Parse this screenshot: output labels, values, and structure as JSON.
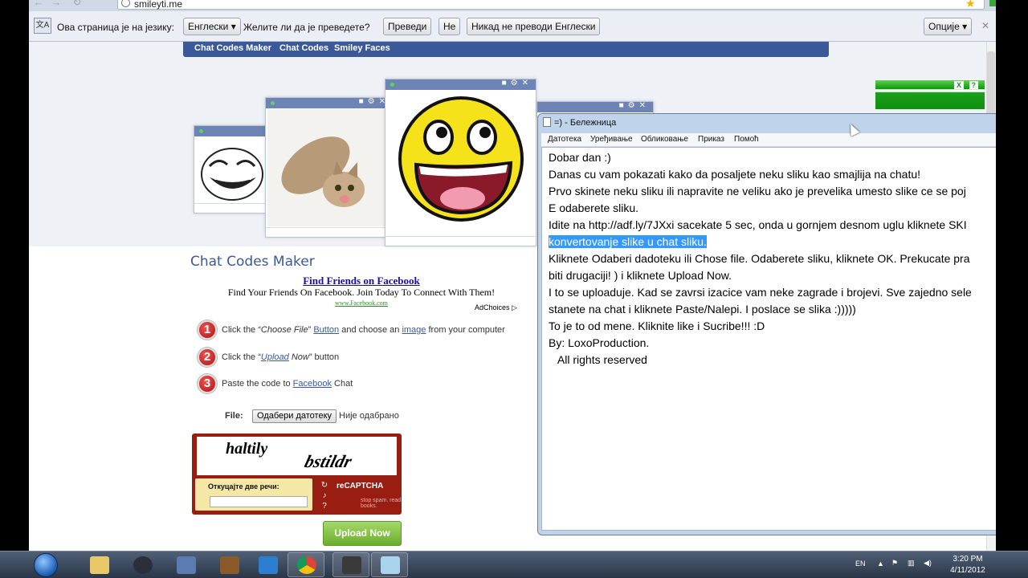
{
  "browser": {
    "url": "smileyti.me",
    "back_icon": "back-arrow-icon",
    "forward_icon": "forward-arrow-icon",
    "reload_icon": "reload-icon"
  },
  "translate_bar": {
    "label": "Ова страница је на језику:",
    "language": "Енглески",
    "question": "Желите ли да је преведете?",
    "translate_btn": "Преведи",
    "no_btn": "Не",
    "never_btn": "Никад не преводи Енглески",
    "options_btn": "Опције",
    "close": "✕"
  },
  "site_nav": {
    "items": [
      "Chat Codes Maker",
      "Chat Codes",
      "Smiley Faces"
    ]
  },
  "greenbar": {
    "close": "X",
    "help": "?"
  },
  "maker": {
    "title": "Chat Codes Maker",
    "ad_title": "Find Friends on Facebook",
    "ad_desc": "Find Your Friends On Facebook. Join Today To Connect With Them!",
    "ad_url": "www.Facebook.com",
    "adchoices": "AdChoices",
    "steps": [
      {
        "num": "1",
        "pre": "Click the “",
        "em": "Choose File",
        "mid": "” ",
        "link": "Button",
        "mid2": " and choose an ",
        "link2": "image",
        "post": " from your computer"
      },
      {
        "num": "2",
        "pre": "Click the “",
        "link": "Upload",
        "em": " Now",
        "post": "” button"
      },
      {
        "num": "3",
        "pre": "Paste the code to ",
        "link": "Facebook",
        "post": " Chat"
      }
    ],
    "file_label": "File:",
    "file_btn": "Одабери датотеку",
    "file_none": "Није одабрано",
    "captcha_word1": "haltily",
    "captcha_word2": "bstildr",
    "captcha_prompt": "Откуцајте две речи:",
    "captcha_logo": "reCAPTCHA",
    "captcha_tag": "stop spam. read books.",
    "upload_btn": "Upload Now"
  },
  "notepad": {
    "title": "=) - Бележница",
    "menu": [
      "Датотека",
      "Уређивање",
      "Обликовање",
      "Приказ",
      "Помоћ"
    ],
    "lines": [
      "Dobar dan :)",
      "Danas cu vam pokazati kako da posaljete neku sliku kao smajlija na chatu!",
      "Prvo skinete neku sliku ili napravite ne veliku ako je prevelika umesto slike ce se poj",
      "E odaberete sliku.",
      "Idite na  http://adf.ly/7JXxi sacekate 5 sec, onda u gornjem desnom uglu kliknete SKI",
      "konvertovanje slike u chat sliku.",
      "Kliknete Odaberi dadoteku ili Chose file. Odaberete sliku, kliknete OK. Prekucate pra",
      "biti drugaciji! ) i kliknete Upload Now.",
      "I to se uploaduje. Kad se zavrsi izacice vam neke zagrade i brojevi. Sve zajedno sele",
      "stanete na chat i kliknete Paste/Nalepi. I poslace se slika :)))))",
      "To je to od mene. Kliknite like i Sucribe!!! :D",
      "By: LoxoProduction.",
      "   All rights reserved"
    ]
  },
  "taskbar": {
    "lang": "EN",
    "time": "3:20 PM",
    "date": "4/11/2012",
    "items": [
      "explorer",
      "steam",
      "network",
      "cowboy",
      "app",
      "chrome",
      "camera",
      "notepad"
    ]
  },
  "colors": {
    "fb_blue": "#3b5998",
    "selection": "#3399ff",
    "upload_green": "#6aae2d"
  }
}
